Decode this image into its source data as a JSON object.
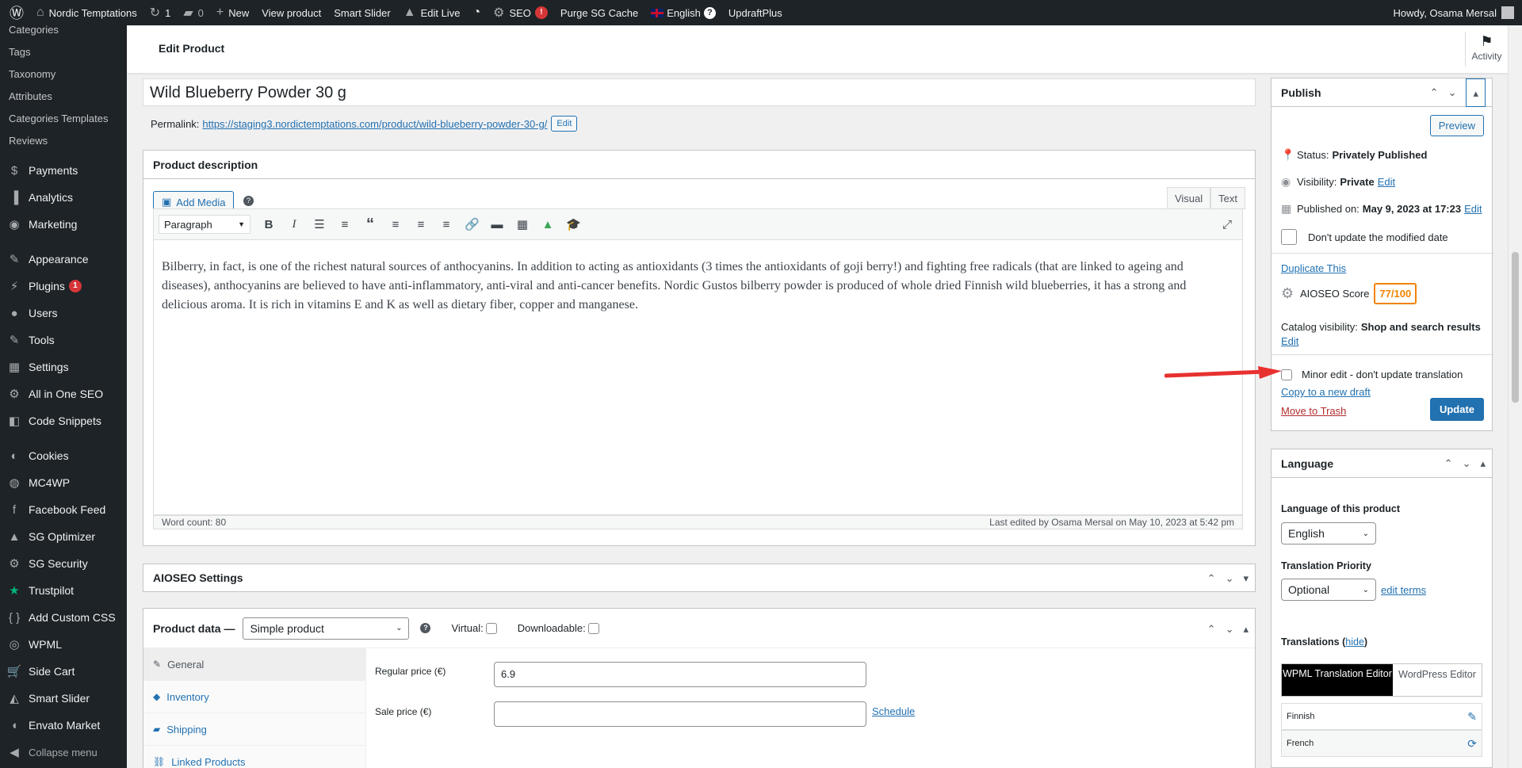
{
  "adminbar": {
    "site": "Nordic Temptations",
    "updates": "1",
    "comments": "0",
    "new": "New",
    "view_product": "View product",
    "smart_slider": "Smart Slider",
    "edit_live": "Edit Live",
    "seo": "SEO",
    "seo_badge": "!",
    "purge": "Purge SG Cache",
    "language": "English",
    "updraft": "UpdraftPlus",
    "howdy": "Howdy, Osama Mersal"
  },
  "sidebar": {
    "submenu": [
      "Categories",
      "Tags",
      "Taxonomy",
      "Attributes",
      "Categories Templates",
      "Reviews"
    ],
    "items": [
      {
        "label": "Payments",
        "icon": "payments-icon",
        "glyph": "$"
      },
      {
        "label": "Analytics",
        "icon": "analytics-icon",
        "glyph": "▐"
      },
      {
        "label": "Marketing",
        "icon": "marketing-icon",
        "glyph": "◉"
      },
      {
        "label": "Appearance",
        "icon": "appearance-icon",
        "glyph": "✎"
      },
      {
        "label": "Plugins",
        "icon": "plugins-icon",
        "glyph": "⚡",
        "badge": "1"
      },
      {
        "label": "Users",
        "icon": "users-icon",
        "glyph": "●"
      },
      {
        "label": "Tools",
        "icon": "tools-icon",
        "glyph": "✎"
      },
      {
        "label": "Settings",
        "icon": "settings-icon",
        "glyph": "▦"
      },
      {
        "label": "All in One SEO",
        "icon": "aioseo-icon",
        "glyph": "⚙"
      },
      {
        "label": "Code Snippets",
        "icon": "code-snippets-icon",
        "glyph": "◧"
      },
      {
        "label": "Cookies",
        "icon": "cookies-icon",
        "glyph": "◐"
      },
      {
        "label": "MC4WP",
        "icon": "mc4wp-icon",
        "glyph": "◍"
      },
      {
        "label": "Facebook Feed",
        "icon": "facebook-icon",
        "glyph": "f"
      },
      {
        "label": "SG Optimizer",
        "icon": "sg-optimizer-icon",
        "glyph": "▲"
      },
      {
        "label": "SG Security",
        "icon": "sg-security-icon",
        "glyph": "⚙"
      },
      {
        "label": "Trustpilot",
        "icon": "trustpilot-icon",
        "glyph": "★"
      },
      {
        "label": "Add Custom CSS",
        "icon": "css-icon",
        "glyph": "{ }"
      },
      {
        "label": "WPML",
        "icon": "wpml-icon",
        "glyph": "◎"
      },
      {
        "label": "Side Cart",
        "icon": "side-cart-icon",
        "glyph": "🛒"
      },
      {
        "label": "Smart Slider",
        "icon": "smart-slider-icon",
        "glyph": "◭"
      },
      {
        "label": "Envato Market",
        "icon": "envato-icon",
        "glyph": "◖"
      },
      {
        "label": "Collapse menu",
        "icon": "collapse-icon",
        "glyph": "◀"
      }
    ]
  },
  "header": {
    "title": "Edit Product",
    "activity": "Activity"
  },
  "product": {
    "title": "Wild Blueberry Powder 30 g",
    "permalink_label": "Permalink:",
    "permalink_url": "https://staging3.nordictemptations.com/product/wild-blueberry-powder-30-g/",
    "permalink_edit": "Edit"
  },
  "description": {
    "title": "Product description",
    "add_media": "Add Media",
    "tab_visual": "Visual",
    "tab_text": "Text",
    "format": "Paragraph",
    "content": "Bilberry, in fact, is one of the richest natural sources of anthocyanins. In addition to acting as antioxidants (3 times the antioxidants of goji berry!) and fighting free radicals (that are linked to ageing and diseases), anthocyanins are believed to have anti-inflammatory, anti-viral and anti-cancer benefits. Nordic Gustos bilberry powder is produced of whole dried Finnish wild blueberries, it has a strong and delicious aroma. It is rich in vitamins E and K as well as dietary fiber, copper and manganese.",
    "word_count": "Word count: 80",
    "last_edited": "Last edited by Osama Mersal on May 10, 2023 at 5:42 pm"
  },
  "aioseo": {
    "title": "AIOSEO Settings"
  },
  "product_data": {
    "title": "Product data —",
    "type": "Simple product",
    "virtual": "Virtual:",
    "downloadable": "Downloadable:",
    "tabs": [
      "General",
      "Inventory",
      "Shipping",
      "Linked Products"
    ],
    "regular_price_label": "Regular price (€)",
    "regular_price": "6.9",
    "sale_price_label": "Sale price (€)",
    "sale_price": "",
    "schedule": "Schedule"
  },
  "publish": {
    "title": "Publish",
    "preview": "Preview",
    "status_label": "Status:",
    "status": "Privately Published",
    "visibility_label": "Visibility:",
    "visibility": "Private",
    "visibility_edit": "Edit",
    "published_label": "Published on:",
    "published": "May 9, 2023 at 17:23",
    "published_edit": "Edit",
    "dont_update": "Don't update the modified date",
    "duplicate": "Duplicate This",
    "aioseo_label": "AIOSEO Score",
    "aioseo_score": "77/100",
    "catalog_label": "Catalog visibility:",
    "catalog": "Shop and search results",
    "catalog_edit": "Edit",
    "minor_edit": "Minor edit - don't update translation",
    "copy_draft": "Copy to a new draft",
    "trash": "Move to Trash",
    "update": "Update"
  },
  "language_box": {
    "title": "Language",
    "lang_label": "Language of this product",
    "lang": "English",
    "priority_label": "Translation Priority",
    "priority": "Optional",
    "edit_terms": "edit terms",
    "translations": "Translations (",
    "hide": "hide",
    "translations_close": ")",
    "wpml_editor": "WPML Translation Editor",
    "wp_editor": "WordPress Editor",
    "langs": [
      "Finnish",
      "French"
    ]
  },
  "colors": {
    "accent": "#2271b1",
    "adminbar": "#1d2327",
    "badge": "#d63638",
    "score": "#f18200",
    "arrow": "#e8312f"
  }
}
